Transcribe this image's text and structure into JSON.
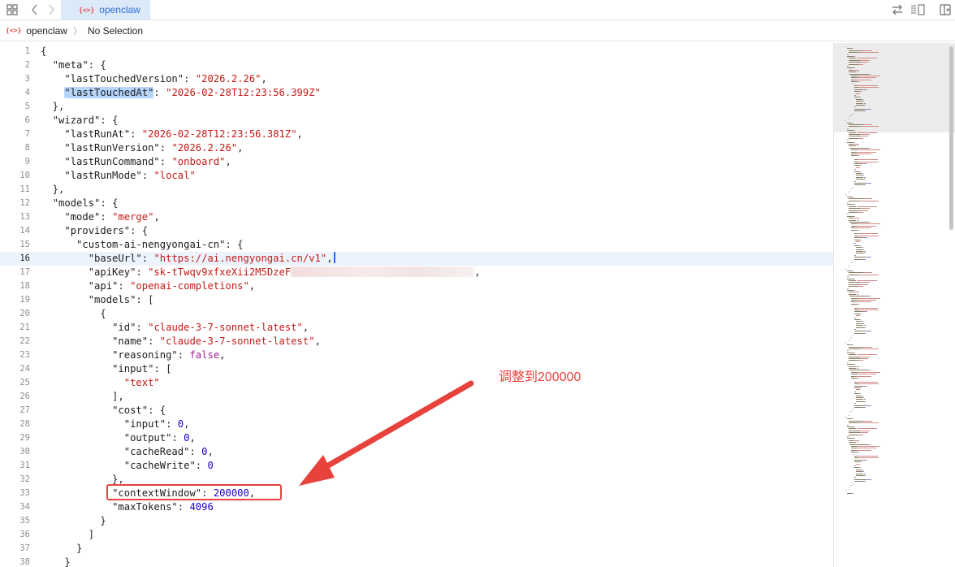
{
  "toolbar": {
    "grid_icon": "grid-icon",
    "back_icon": "chevron-left-icon",
    "forward_icon": "chevron-right-icon",
    "tab_icon_text": "{<>}",
    "tab_label": "openclaw",
    "swap_icon": "swap-arrows-icon",
    "lines_icon": "text-lines-icon",
    "split_icon": "add-editor-icon"
  },
  "breadcrumb": {
    "icon_text": "{<>}",
    "file": "openclaw",
    "separator": "〉",
    "selection": "No Selection"
  },
  "editor": {
    "active_line": 16,
    "lines": [
      {
        "n": "1",
        "tokens": [
          [
            "p",
            "{"
          ]
        ]
      },
      {
        "n": "2",
        "tokens": [
          [
            "p",
            "  "
          ],
          [
            "k",
            "\"meta\""
          ],
          [
            "p",
            ": {"
          ]
        ]
      },
      {
        "n": "3",
        "tokens": [
          [
            "p",
            "    "
          ],
          [
            "k",
            "\"lastTouchedVersion\""
          ],
          [
            "p",
            ": "
          ],
          [
            "s",
            "\"2026.2.26\""
          ],
          [
            "p",
            ","
          ]
        ]
      },
      {
        "n": "4",
        "tokens": [
          [
            "p",
            "    "
          ],
          [
            "h",
            "\"lastTouchedAt\""
          ],
          [
            "p",
            ": "
          ],
          [
            "s",
            "\"2026-02-28T12:23:56.399Z\""
          ]
        ]
      },
      {
        "n": "5",
        "tokens": [
          [
            "p",
            "  },"
          ]
        ]
      },
      {
        "n": "6",
        "tokens": [
          [
            "p",
            "  "
          ],
          [
            "k",
            "\"wizard\""
          ],
          [
            "p",
            ": {"
          ]
        ]
      },
      {
        "n": "7",
        "tokens": [
          [
            "p",
            "    "
          ],
          [
            "k",
            "\"lastRunAt\""
          ],
          [
            "p",
            ": "
          ],
          [
            "s",
            "\"2026-02-28T12:23:56.381Z\""
          ],
          [
            "p",
            ","
          ]
        ]
      },
      {
        "n": "8",
        "tokens": [
          [
            "p",
            "    "
          ],
          [
            "k",
            "\"lastRunVersion\""
          ],
          [
            "p",
            ": "
          ],
          [
            "s",
            "\"2026.2.26\""
          ],
          [
            "p",
            ","
          ]
        ]
      },
      {
        "n": "9",
        "tokens": [
          [
            "p",
            "    "
          ],
          [
            "k",
            "\"lastRunCommand\""
          ],
          [
            "p",
            ": "
          ],
          [
            "s",
            "\"onboard\""
          ],
          [
            "p",
            ","
          ]
        ]
      },
      {
        "n": "10",
        "tokens": [
          [
            "p",
            "    "
          ],
          [
            "k",
            "\"lastRunMode\""
          ],
          [
            "p",
            ": "
          ],
          [
            "s",
            "\"local\""
          ]
        ]
      },
      {
        "n": "11",
        "tokens": [
          [
            "p",
            "  },"
          ]
        ]
      },
      {
        "n": "12",
        "tokens": [
          [
            "p",
            "  "
          ],
          [
            "k",
            "\"models\""
          ],
          [
            "p",
            ": {"
          ]
        ]
      },
      {
        "n": "13",
        "tokens": [
          [
            "p",
            "    "
          ],
          [
            "k",
            "\"mode\""
          ],
          [
            "p",
            ": "
          ],
          [
            "s",
            "\"merge\""
          ],
          [
            "p",
            ","
          ]
        ]
      },
      {
        "n": "14",
        "tokens": [
          [
            "p",
            "    "
          ],
          [
            "k",
            "\"providers\""
          ],
          [
            "p",
            ": {"
          ]
        ]
      },
      {
        "n": "15",
        "tokens": [
          [
            "p",
            "      "
          ],
          [
            "k",
            "\"custom-ai-nengyongai-cn\""
          ],
          [
            "p",
            ": {"
          ]
        ]
      },
      {
        "n": "16",
        "tokens": [
          [
            "p",
            "        "
          ],
          [
            "k",
            "\"baseUrl\""
          ],
          [
            "p",
            ": "
          ],
          [
            "s",
            "\"https://ai.nengyongai.cn/v1\""
          ],
          [
            "p",
            ","
          ],
          [
            "c",
            ""
          ]
        ]
      },
      {
        "n": "17",
        "tokens": [
          [
            "p",
            "        "
          ],
          [
            "k",
            "\"apiKey\""
          ],
          [
            "p",
            ": "
          ],
          [
            "s",
            "\"sk-tTwqv9xfxeXii2M5DzeF"
          ],
          [
            "r",
            ""
          ],
          [
            "p",
            ","
          ]
        ]
      },
      {
        "n": "18",
        "tokens": [
          [
            "p",
            "        "
          ],
          [
            "k",
            "\"api\""
          ],
          [
            "p",
            ": "
          ],
          [
            "s",
            "\"openai-completions\""
          ],
          [
            "p",
            ","
          ]
        ]
      },
      {
        "n": "19",
        "tokens": [
          [
            "p",
            "        "
          ],
          [
            "k",
            "\"models\""
          ],
          [
            "p",
            ": ["
          ]
        ]
      },
      {
        "n": "20",
        "tokens": [
          [
            "p",
            "          {"
          ]
        ]
      },
      {
        "n": "21",
        "tokens": [
          [
            "p",
            "            "
          ],
          [
            "k",
            "\"id\""
          ],
          [
            "p",
            ": "
          ],
          [
            "s",
            "\"claude-3-7-sonnet-latest\""
          ],
          [
            "p",
            ","
          ]
        ]
      },
      {
        "n": "22",
        "tokens": [
          [
            "p",
            "            "
          ],
          [
            "k",
            "\"name\""
          ],
          [
            "p",
            ": "
          ],
          [
            "s",
            "\"claude-3-7-sonnet-latest\""
          ],
          [
            "p",
            ","
          ]
        ]
      },
      {
        "n": "23",
        "tokens": [
          [
            "p",
            "            "
          ],
          [
            "k",
            "\"reasoning\""
          ],
          [
            "p",
            ": "
          ],
          [
            "b",
            "false"
          ],
          [
            "p",
            ","
          ]
        ]
      },
      {
        "n": "24",
        "tokens": [
          [
            "p",
            "            "
          ],
          [
            "k",
            "\"input\""
          ],
          [
            "p",
            ": ["
          ]
        ]
      },
      {
        "n": "25",
        "tokens": [
          [
            "p",
            "              "
          ],
          [
            "s",
            "\"text\""
          ]
        ]
      },
      {
        "n": "26",
        "tokens": [
          [
            "p",
            "            ],"
          ]
        ]
      },
      {
        "n": "27",
        "tokens": [
          [
            "p",
            "            "
          ],
          [
            "k",
            "\"cost\""
          ],
          [
            "p",
            ": {"
          ]
        ]
      },
      {
        "n": "28",
        "tokens": [
          [
            "p",
            "              "
          ],
          [
            "k",
            "\"input\""
          ],
          [
            "p",
            ": "
          ],
          [
            "n",
            "0"
          ],
          [
            "p",
            ","
          ]
        ]
      },
      {
        "n": "29",
        "tokens": [
          [
            "p",
            "              "
          ],
          [
            "k",
            "\"output\""
          ],
          [
            "p",
            ": "
          ],
          [
            "n",
            "0"
          ],
          [
            "p",
            ","
          ]
        ]
      },
      {
        "n": "30",
        "tokens": [
          [
            "p",
            "              "
          ],
          [
            "k",
            "\"cacheRead\""
          ],
          [
            "p",
            ": "
          ],
          [
            "n",
            "0"
          ],
          [
            "p",
            ","
          ]
        ]
      },
      {
        "n": "31",
        "tokens": [
          [
            "p",
            "              "
          ],
          [
            "k",
            "\"cacheWrite\""
          ],
          [
            "p",
            ": "
          ],
          [
            "n",
            "0"
          ]
        ]
      },
      {
        "n": "32",
        "tokens": [
          [
            "p",
            "            },"
          ]
        ]
      },
      {
        "n": "33",
        "tokens": [
          [
            "p",
            "            "
          ],
          [
            "k",
            "\"contextWindow\""
          ],
          [
            "p",
            ": "
          ],
          [
            "n",
            "200000"
          ],
          [
            "p",
            ","
          ]
        ]
      },
      {
        "n": "34",
        "tokens": [
          [
            "p",
            "            "
          ],
          [
            "k",
            "\"maxTokens\""
          ],
          [
            "p",
            ": "
          ],
          [
            "n",
            "4096"
          ]
        ]
      },
      {
        "n": "35",
        "tokens": [
          [
            "p",
            "          }"
          ]
        ]
      },
      {
        "n": "36",
        "tokens": [
          [
            "p",
            "        ]"
          ]
        ]
      },
      {
        "n": "37",
        "tokens": [
          [
            "p",
            "      }"
          ]
        ]
      },
      {
        "n": "38",
        "tokens": [
          [
            "p",
            "    }"
          ]
        ]
      }
    ]
  },
  "annotation": {
    "label": "调整到200000",
    "color": "#e8423d"
  },
  "colors": {
    "key": "#1d1d1f",
    "string": "#c41a16",
    "number": "#1c00cf",
    "keyword": "#9b2393",
    "accent": "#2f6fd6"
  }
}
